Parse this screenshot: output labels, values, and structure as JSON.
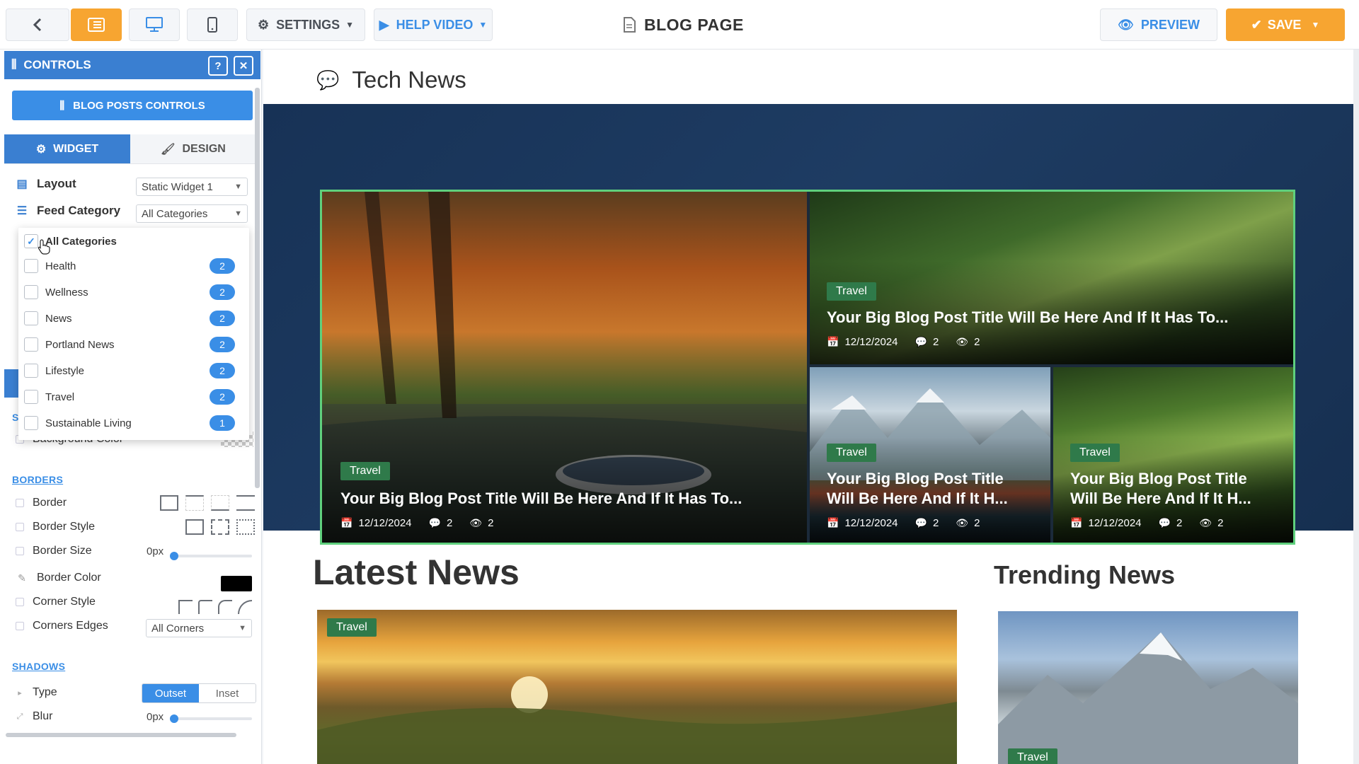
{
  "topbar": {
    "settings_label": "SETTINGS",
    "help_label": "HELP VIDEO",
    "page_title": "BLOG PAGE",
    "preview_label": "PREVIEW",
    "save_label": "SAVE"
  },
  "panel": {
    "header": "CONTROLS",
    "blog_posts_controls": "BLOG POSTS CONTROLS",
    "tabs": [
      {
        "label": "WIDGET"
      },
      {
        "label": "DESIGN"
      }
    ],
    "layout_label": "Layout",
    "layout_value": "Static Widget 1",
    "feed_label": "Feed Category",
    "feed_value": "All Categories",
    "dropdown": [
      {
        "label": "All Categories",
        "checked": true,
        "count": ""
      },
      {
        "label": "Health",
        "checked": false,
        "count": "2"
      },
      {
        "label": "Wellness",
        "checked": false,
        "count": "2"
      },
      {
        "label": "News",
        "checked": false,
        "count": "2"
      },
      {
        "label": "Portland News",
        "checked": false,
        "count": "2"
      },
      {
        "label": "Lifestyle",
        "checked": false,
        "count": "2"
      },
      {
        "label": "Travel",
        "checked": false,
        "count": "2"
      },
      {
        "label": "Sustainable Living",
        "checked": false,
        "count": "1"
      }
    ],
    "partial_section_letter": "S",
    "background_color_label": "Background Color",
    "borders_heading": "BORDERS",
    "border_label": "Border",
    "border_style_label": "Border Style",
    "border_size_label": "Border Size",
    "border_size_value": "0px",
    "border_color_label": "Border Color",
    "corner_style_label": "Corner Style",
    "corners_edges_label": "Corners Edges",
    "corners_edges_value": "All Corners",
    "shadows_heading": "SHADOWS",
    "type_label": "Type",
    "type_options": [
      "Outset",
      "Inset"
    ],
    "blur_label": "Blur",
    "blur_value": "0px"
  },
  "canvas": {
    "hero_title": "Tech News",
    "cards": [
      {
        "badge": "Travel",
        "title": "Your Big Blog Post Title Will Be Here And If It Has To...",
        "date": "12/12/2024",
        "comments": "2",
        "views": "2"
      },
      {
        "badge": "Travel",
        "title": "Your Big Blog Post Title Will Be Here And If It Has To...",
        "date": "12/12/2024",
        "comments": "2",
        "views": "2"
      },
      {
        "badge": "Travel",
        "title_line1": "Your Big Blog Post Title",
        "title_line2": "Will Be Here And If It H...",
        "date": "12/12/2024",
        "comments": "2",
        "views": "2"
      },
      {
        "badge": "Travel",
        "title_line1": "Your Big Blog Post Title",
        "title_line2": "Will Be Here And If It H...",
        "date": "12/12/2024",
        "comments": "2",
        "views": "2"
      }
    ],
    "latest_title": "Latest News",
    "latest_badge": "Travel",
    "trending_title": "Trending News",
    "trending_badge": "Travel"
  },
  "colors": {
    "accent_orange": "#f7a531",
    "accent_blue": "#3a8ee6",
    "badge_green": "#2f7a4a",
    "hero_border": "#5fd07d"
  }
}
